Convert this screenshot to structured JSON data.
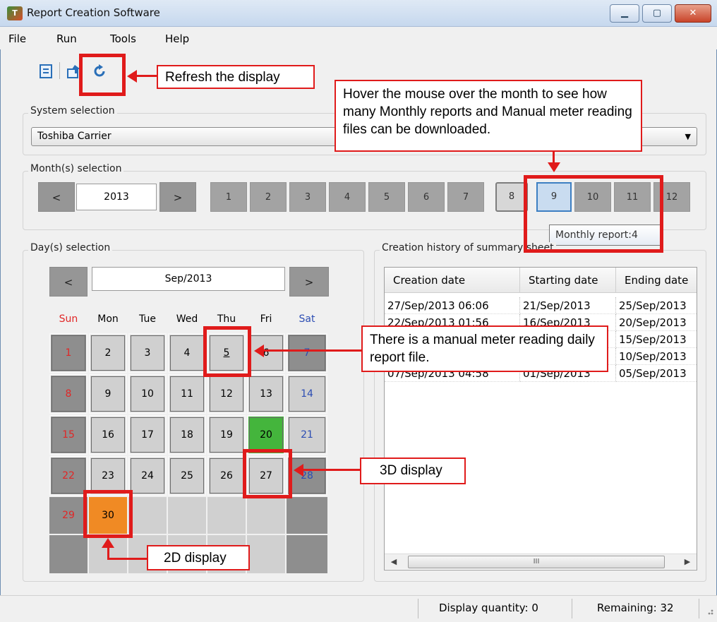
{
  "window": {
    "title": "Report Creation Software",
    "app_icon": "app-logo-icon"
  },
  "menu": [
    "File",
    "Run",
    "Tools",
    "Help"
  ],
  "toolbar": {
    "icons": [
      "report-icon",
      "export-icon",
      "refresh-icon"
    ]
  },
  "system_selection": {
    "label": "System selection",
    "value": "Toshiba Carrier"
  },
  "month_selection": {
    "label": "Month(s) selection",
    "prev": "<",
    "year": "2013",
    "next": ">",
    "months": [
      "1",
      "2",
      "3",
      "4",
      "5",
      "6",
      "7",
      "8",
      "9",
      "10",
      "11",
      "12"
    ],
    "tooltip": "Monthly report:4"
  },
  "day_selection": {
    "label": "Day(s) selection",
    "prev": "<",
    "month": "Sep/2013",
    "next": ">",
    "weekdays": [
      "Sun",
      "Mon",
      "Tue",
      "Wed",
      "Thu",
      "Fri",
      "Sat"
    ],
    "days": [
      "1",
      "2",
      "3",
      "4",
      "5",
      "6",
      "7",
      "8",
      "9",
      "10",
      "11",
      "12",
      "13",
      "14",
      "15",
      "16",
      "17",
      "18",
      "19",
      "20",
      "21",
      "22",
      "23",
      "24",
      "25",
      "26",
      "27",
      "28",
      "29",
      "30"
    ],
    "underlined_day": "5",
    "colors": {
      "green_day": "#44b53c",
      "orange_day": "#f08a24",
      "sunday": "#e12626",
      "saturday": "#2c4db3"
    }
  },
  "history": {
    "label": "Creation history of summary sheet",
    "columns": [
      "Creation date",
      "Starting date",
      "Ending date"
    ],
    "rows": [
      [
        "27/Sep/2013 06:06",
        "21/Sep/2013",
        "25/Sep/2013"
      ],
      [
        "22/Sep/2013 01:56",
        "16/Sep/2013",
        "20/Sep/2013"
      ],
      [
        "",
        "",
        "15/Sep/2013"
      ],
      [
        "",
        "",
        "10/Sep/2013"
      ],
      [
        "07/Sep/2013 04:58",
        "01/Sep/2013",
        "05/Sep/2013"
      ]
    ],
    "scroll_mid": "III"
  },
  "status": {
    "display_quantity": "Display quantity: 0",
    "remaining": "Remaining: 32"
  },
  "annotations": {
    "refresh": "Refresh the display",
    "hover": "Hover the mouse over the month to see how many Monthly reports and Manual meter reading files can be downloaded.",
    "manual": "There is a manual meter reading daily report file.",
    "display3d": "3D display",
    "display2d": "2D display",
    "accent": "#e01b1b"
  }
}
